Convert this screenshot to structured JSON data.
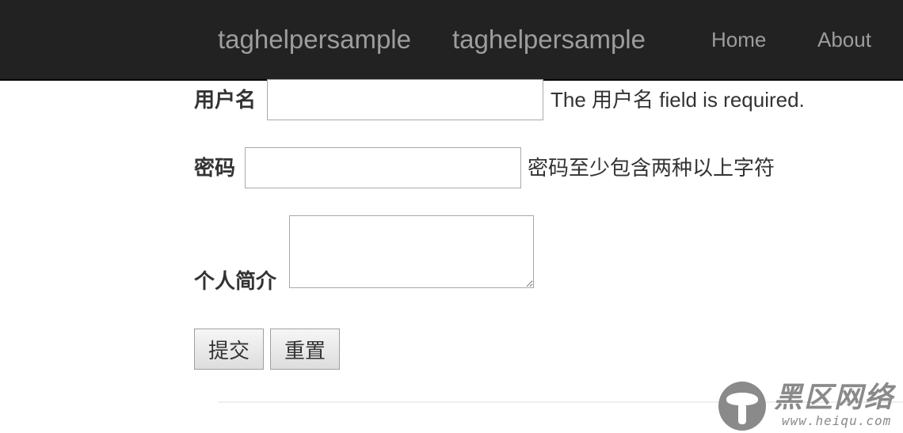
{
  "navbar": {
    "brand_primary": "taghelpersample",
    "brand_secondary": "taghelpersample",
    "links": [
      {
        "label": "Home"
      },
      {
        "label": "About"
      }
    ]
  },
  "form": {
    "username": {
      "label": "用户名",
      "value": "",
      "validation_message": "The 用户名 field is required."
    },
    "password": {
      "label": "密码",
      "value": "",
      "validation_message": "密码至少包含两种以上字符"
    },
    "bio": {
      "label": "个人简介",
      "value": ""
    },
    "submit_label": "提交",
    "reset_label": "重置"
  },
  "watermark": {
    "title": "黑区网络",
    "url": "www.heiqu.com"
  }
}
